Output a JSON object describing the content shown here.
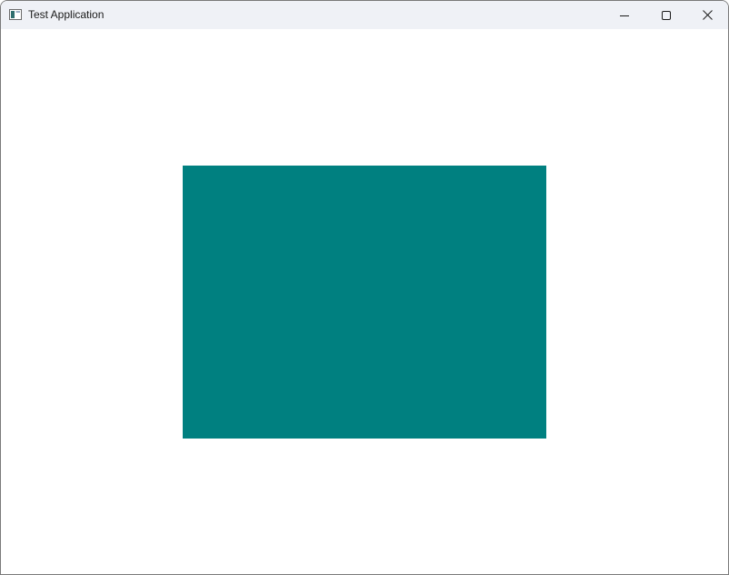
{
  "window": {
    "title": "Test Application",
    "app_icon": "app-window-icon",
    "controls": {
      "minimize_icon": "minimize-icon",
      "maximize_icon": "maximize-icon",
      "close_icon": "close-icon"
    }
  },
  "content": {
    "shape": "rectangle",
    "fill_color": "#008080",
    "background_color": "#ffffff"
  }
}
